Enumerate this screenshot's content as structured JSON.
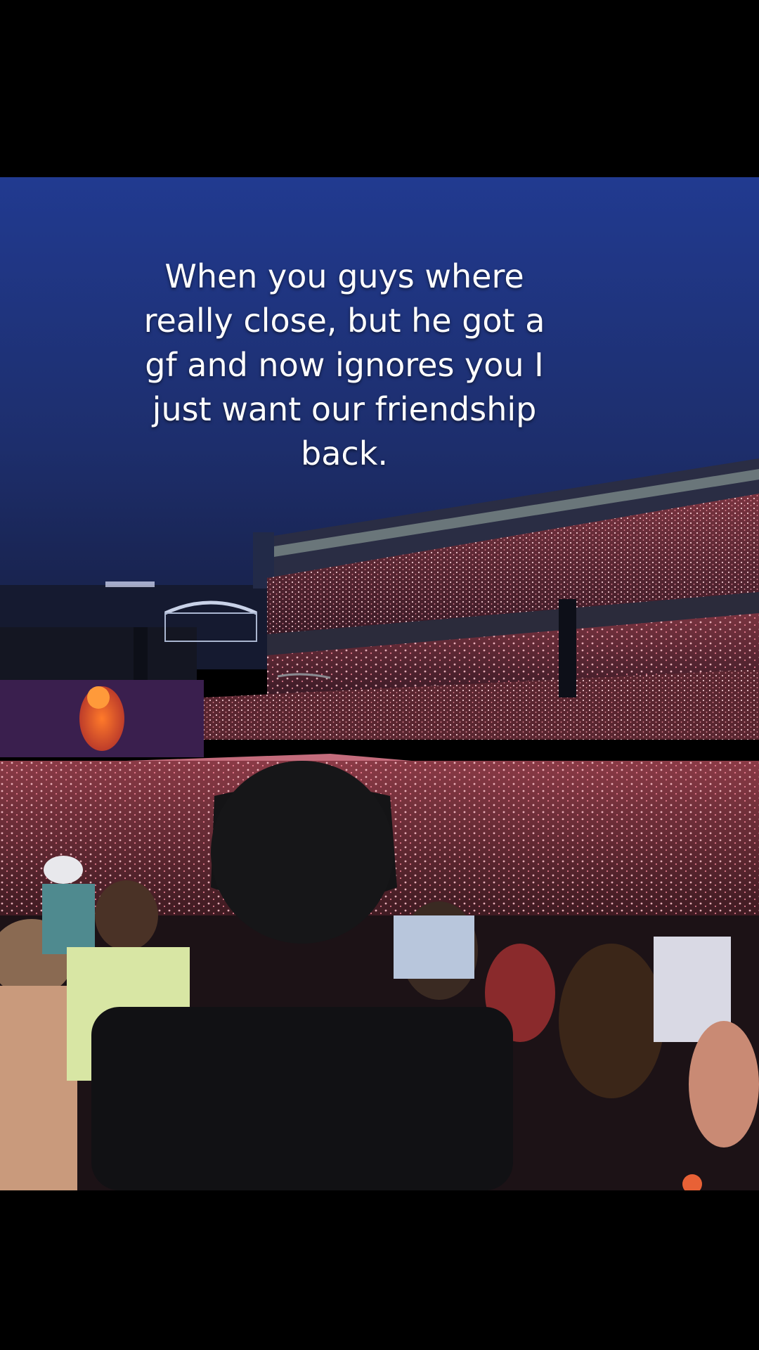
{
  "caption": {
    "lines": [
      "When you guys where",
      "really close, but he got a",
      "gf and now ignores you I",
      "just want our friendship",
      "back."
    ]
  },
  "scene": {
    "description_icon": "concert-stadium-photo",
    "colors": {
      "sky_top": "#1f3a8a",
      "sky_bottom": "#1a2656",
      "crowd_glow": "#e0566b",
      "letterbox": "#000000"
    }
  }
}
